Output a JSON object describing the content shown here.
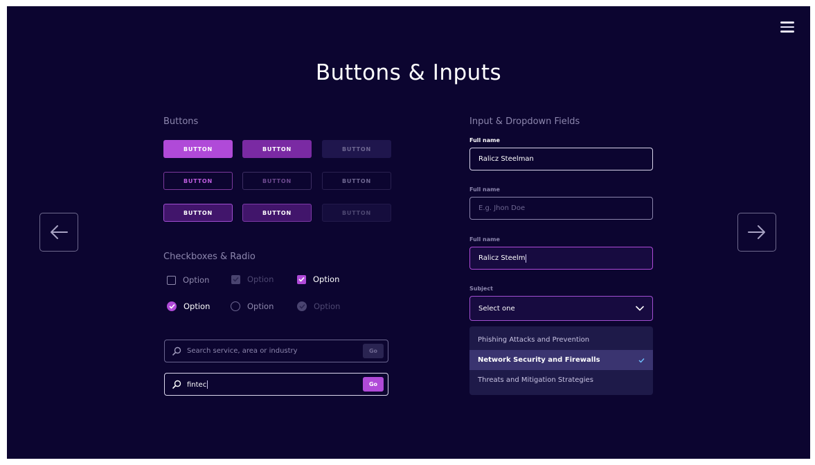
{
  "title": "Buttons & Inputs",
  "colors": {
    "background": "#0c0530",
    "accent": "#b04ad8",
    "text_muted": "#8c86ad"
  },
  "buttons_section": {
    "label": "Buttons",
    "rows": [
      [
        "BUTTON",
        "BUTTON",
        "BUTTON"
      ],
      [
        "BUTTON",
        "BUTTON",
        "BUTTON"
      ],
      [
        "BUTTON",
        "BUTTON",
        "BUTTON"
      ]
    ]
  },
  "checkbox_section": {
    "label": "Checkboxes & Radio",
    "checkboxes": [
      {
        "label": "Option",
        "state": "unchecked"
      },
      {
        "label": "Option",
        "state": "checked-disabled"
      },
      {
        "label": "Option",
        "state": "checked"
      }
    ],
    "radios": [
      {
        "label": "Option",
        "state": "checked"
      },
      {
        "label": "Option",
        "state": "unchecked"
      },
      {
        "label": "Option",
        "state": "checked-disabled"
      }
    ]
  },
  "search": {
    "empty": {
      "placeholder": "Search service, area or industry",
      "go_label": "Go"
    },
    "filled": {
      "value": "fintec",
      "go_label": "Go"
    }
  },
  "inputs_section": {
    "label": "Input & Dropdown Fields",
    "fields": [
      {
        "label": "Full name",
        "value": "Ralicz Steelman",
        "state": "filled"
      },
      {
        "label": "Full name",
        "placeholder": "E.g. Jhon Doe",
        "state": "empty"
      },
      {
        "label": "Full name",
        "value": "Ralicz Steelm",
        "state": "focused"
      }
    ],
    "dropdown": {
      "label": "Subject",
      "selected": "Select one",
      "options": [
        "Phishing Attacks and Prevention",
        "Network Security and Firewalls",
        "Threats and Mitigation Strategies"
      ],
      "highlighted_index": 1
    }
  },
  "icons": {
    "menu": "hamburger-icon",
    "prev": "arrow-left-icon",
    "next": "arrow-right-icon",
    "search": "search-icon",
    "chevron": "chevron-down-icon",
    "check": "check-icon"
  }
}
